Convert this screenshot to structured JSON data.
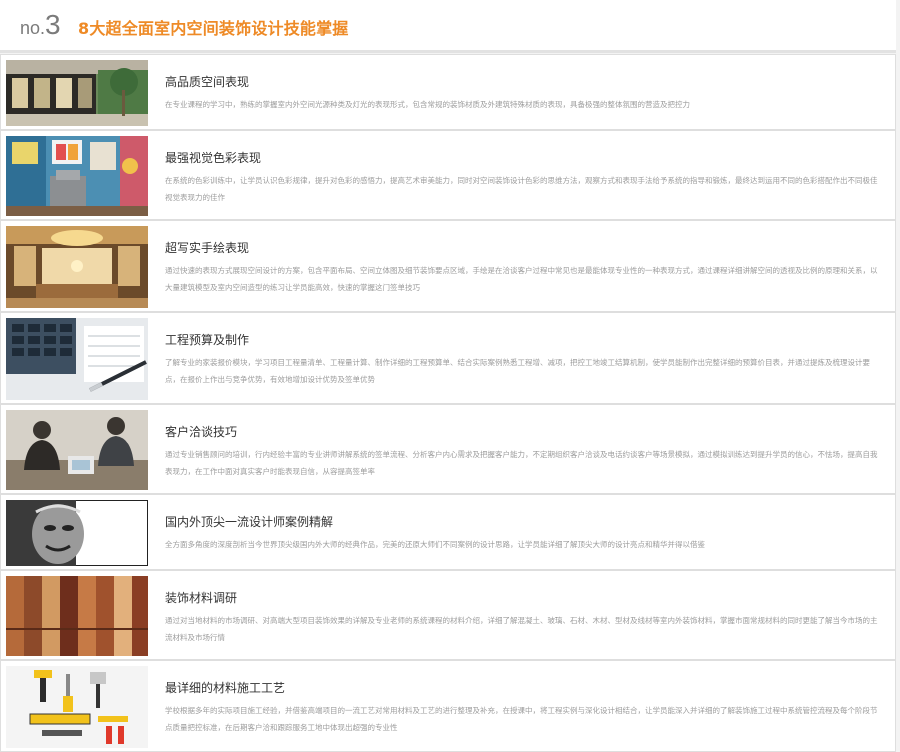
{
  "header": {
    "prefix": "no.",
    "number": "3",
    "title": "8大超全面室内空间装饰设计技能掌握"
  },
  "items": [
    {
      "title": "高品质空间表现",
      "desc": "在专业课程的学习中，熟练的掌握室内外空间光源种类及灯光的表现形式，包含常规的装饰材质及外建筑特殊材质的表现，具备极强的整体氛围的营造及把控力",
      "icon": "modern-villa-photo"
    },
    {
      "title": "最强视觉色彩表现",
      "desc": "在系统的色彩训练中，让学员认识色彩规律，提升对色彩的感悟力，提高艺术审美能力，同时对空间装饰设计色彩的思维方法，观察方式和表现手法给予系统的指导和锻炼，最终达到运用不同的色彩搭配作出不同极佳视觉表现力的佳作",
      "icon": "colorful-interior-photo"
    },
    {
      "title": "超写实手绘表现",
      "desc": "通过快速的表现方式展现空间设计的方案，包含平面布局、空间立体图及细节装饰要点区域，手绘是在洽谈客户过程中常见也是最能体现专业性的一种表现方式，通过课程详细讲解空间的透视及比例的原理和关系，以大量建筑模型及室内空间造型的练习让学员能高效，快速的掌握这门签单技巧",
      "icon": "luxury-hall-photo"
    },
    {
      "title": "工程预算及制作",
      "desc": "了解专业的家装报价模块，学习项目工程量清单、工程量计算、制作详细的工程预算单、结合实际案例熟悉工程增、减项，把控工地竣工结算机制，使学员能制作出完整详细的预算价目表，并通过提炼及梳理设计要点，在报价上作出与竞争优势，有效地增加设计优势及签单优势",
      "icon": "calculator-pen-photo"
    },
    {
      "title": "客户洽谈技巧",
      "desc": "通过专业销售顾问的培训，行内经验丰富的专业讲师讲解系统的签单流程、分析客户内心需求及把握客户能力，不定期组织客户洽谈及电话约谈客户等场景模拟，通过模拟训练达到提升学员的信心，不怯场，提高自我表现力，在工作中面对真实客户时能表现自信，从容提高签单率",
      "icon": "meeting-photo"
    },
    {
      "title": "国内外顶尖一流设计师案例精解",
      "desc": "全方面多角度的深度剖析当今世界顶尖级国内外大师的经典作品，完美的还原大师们不同案例的设计思路，让学员能详细了解顶尖大师的设计亮点和精华并得以借鉴",
      "icon": "portrait-sketch-photo"
    },
    {
      "title": "装饰材料调研",
      "desc": "通过对当地材料的市场调研、对高端大型项目装饰效果的详解及专业老师的系统课程的材料介绍，详细了解混凝土、玻璃、石材、木材、型材及线材等室内外装饰材料，掌握市面常规材料的同时更能了解当今市场的主流材料及市场行情",
      "icon": "wood-samples-photo"
    },
    {
      "title": "最详细的材料施工工艺",
      "desc": "学校根据多年的实际项目施工经验，并借鉴高端项目的一流工艺对常用材料及工艺的进行整理及补充，在授课中，将工程实例与深化设计相结合，让学员能深入并详细的了解装饰施工过程中系统管控流程及每个阶段节点质量把控标准，在后期客户洽和跟踪服务工地中体现出超强的专业性",
      "icon": "tools-photo"
    }
  ]
}
